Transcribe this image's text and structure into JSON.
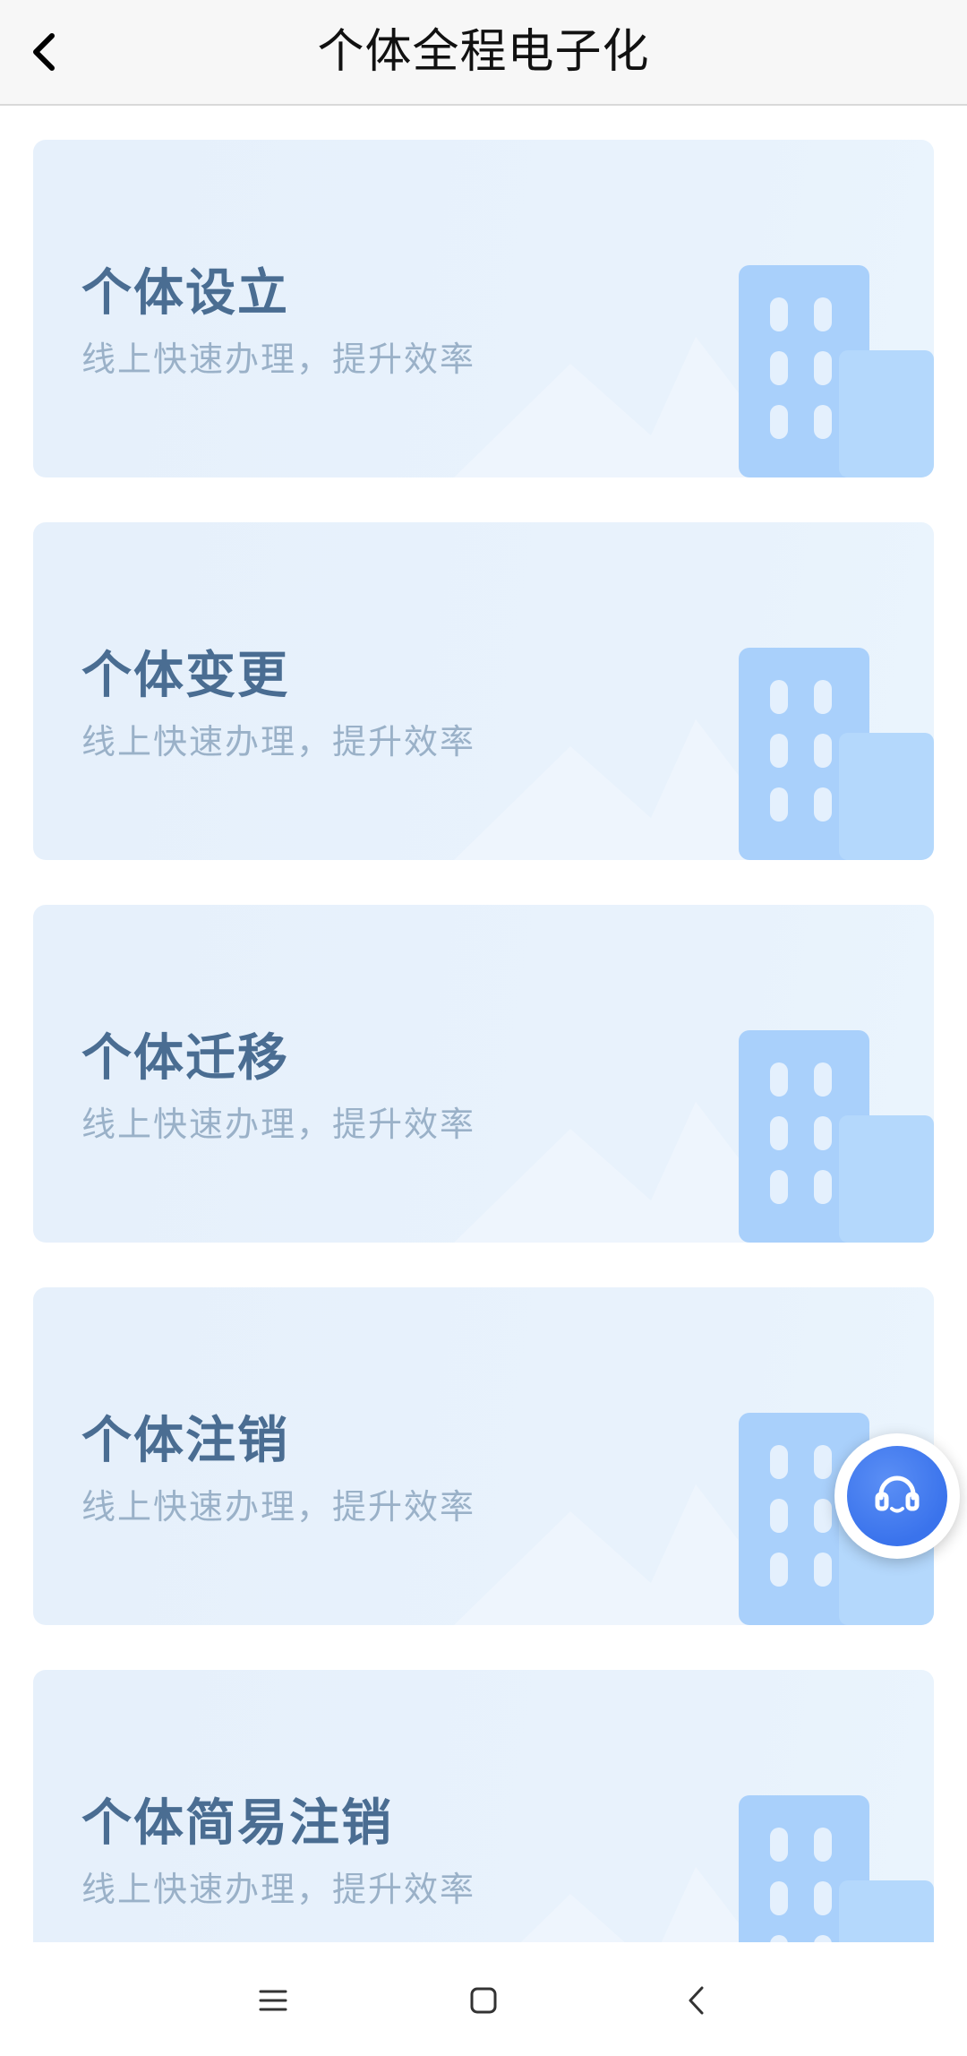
{
  "header": {
    "title": "个体全程电子化",
    "back_icon": "chevron-left-icon"
  },
  "cards": [
    {
      "title": "个体设立",
      "subtitle": "线上快速办理，提升效率"
    },
    {
      "title": "个体变更",
      "subtitle": "线上快速办理，提升效率"
    },
    {
      "title": "个体迁移",
      "subtitle": "线上快速办理，提升效率"
    },
    {
      "title": "个体注销",
      "subtitle": "线上快速办理，提升效率"
    },
    {
      "title": "个体简易注销",
      "subtitle": "线上快速办理，提升效率"
    }
  ],
  "fab": {
    "icon": "customer-service-headset-icon"
  },
  "navbar": {
    "icons": [
      "menu-icon",
      "home-square-icon",
      "back-arrow-icon"
    ]
  },
  "colors": {
    "card_bg": "#e6f0fb",
    "card_title": "#4a6d92",
    "card_subtitle": "#9ab1c8",
    "building": "#a8d0fb",
    "fab": "#3a73ec"
  }
}
